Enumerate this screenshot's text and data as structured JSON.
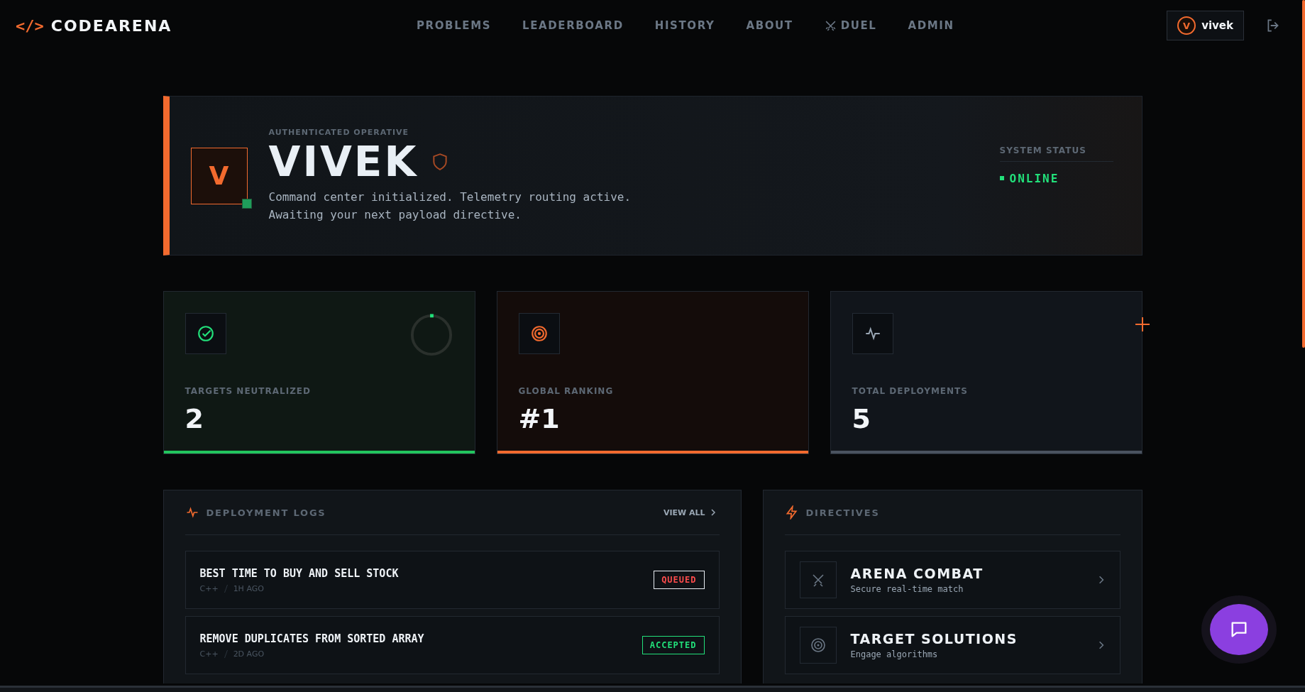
{
  "brand": {
    "symbol": "</>",
    "name": "CODEARENA"
  },
  "nav": [
    {
      "label": "PROBLEMS",
      "icon": false
    },
    {
      "label": "LEADERBOARD",
      "icon": false
    },
    {
      "label": "HISTORY",
      "icon": false
    },
    {
      "label": "ABOUT",
      "icon": false
    },
    {
      "label": "DUEL",
      "icon": true
    },
    {
      "label": "ADMIN",
      "icon": false
    }
  ],
  "user": {
    "initial": "V",
    "name": "vivek"
  },
  "hero": {
    "eyebrow": "AUTHENTICATED OPERATIVE",
    "initial": "V",
    "name": "VIVEK",
    "online_dot": true,
    "lines": [
      "Command center initialized. Telemetry routing active.",
      "Awaiting your next payload directive."
    ],
    "status_label": "SYSTEM STATUS",
    "status": "ONLINE"
  },
  "stats": [
    {
      "kind": "solved",
      "label": "TARGETS NEUTRALIZED",
      "value": "2",
      "color": "#22c55e"
    },
    {
      "kind": "rank",
      "label": "GLOBAL RANKING",
      "value": "#1",
      "color": "#f26a2e"
    },
    {
      "kind": "deploy",
      "label": "TOTAL DEPLOYMENTS",
      "value": "5",
      "color": "#4a5360"
    }
  ],
  "logs": {
    "title": "DEPLOYMENT LOGS",
    "link": "VIEW ALL",
    "items": [
      {
        "title": "BEST TIME TO BUY AND SELL STOCK",
        "lang": "C++",
        "time": "1H AGO",
        "status": "QUEUED",
        "kind": "queued"
      },
      {
        "title": "REMOVE DUPLICATES FROM SORTED ARRAY",
        "lang": "C++",
        "time": "2D AGO",
        "status": "ACCEPTED",
        "kind": "accepted"
      }
    ]
  },
  "directives": {
    "title": "DIRECTIVES",
    "items": [
      {
        "kind": "combat",
        "title": "ARENA COMBAT",
        "subtitle": "Secure real-time match"
      },
      {
        "kind": "target",
        "title": "TARGET SOLUTIONS",
        "subtitle": "Engage algorithms"
      }
    ]
  }
}
